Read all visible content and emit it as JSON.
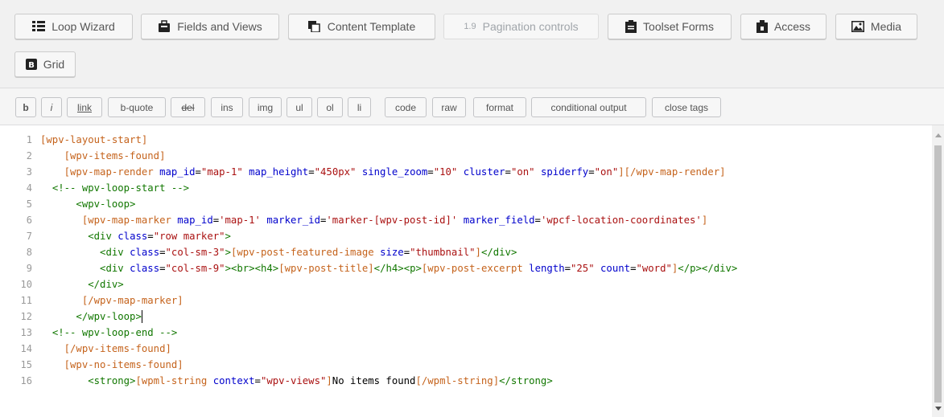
{
  "toolbar": {
    "buttons": [
      {
        "label": "Loop Wizard",
        "icon": "grid-list-icon"
      },
      {
        "label": "Fields and Views",
        "icon": "bag-icon"
      },
      {
        "label": "Content Template",
        "icon": "template-icon"
      },
      {
        "label": "Pagination controls",
        "icon": "pagination-icon",
        "disabled": true
      },
      {
        "label": "Toolset Forms",
        "icon": "clipboard-icon"
      },
      {
        "label": "Access",
        "icon": "access-icon"
      },
      {
        "label": "Media",
        "icon": "image-icon"
      },
      {
        "label": "Grid",
        "icon": "grid-b-icon"
      }
    ],
    "pagination_glyph": "1.9"
  },
  "quicktags": [
    "b",
    "i",
    "link",
    "b-quote",
    "del",
    "ins",
    "img",
    "ul",
    "ol",
    "li",
    "code",
    "raw",
    "format",
    "conditional output",
    "close tags"
  ],
  "editor": {
    "line_numbers": [
      "1",
      "2",
      "3",
      "4",
      "5",
      "6",
      "7",
      "8",
      "9",
      "10",
      "11",
      "12",
      "13",
      "14",
      "15",
      "16"
    ],
    "lines": [
      [
        {
          "t": "sc",
          "v": "[wpv-layout-start]"
        }
      ],
      [
        {
          "t": "p",
          "v": "    "
        },
        {
          "t": "sc",
          "v": "[wpv-items-found]"
        }
      ],
      [
        {
          "t": "p",
          "v": "    "
        },
        {
          "t": "sc",
          "v": "[wpv-map-render "
        },
        {
          "t": "attr",
          "v": "map_id"
        },
        {
          "t": "plain",
          "v": "="
        },
        {
          "t": "str",
          "v": "\"map-1\""
        },
        {
          "t": "plain",
          "v": " "
        },
        {
          "t": "attr",
          "v": "map_height"
        },
        {
          "t": "plain",
          "v": "="
        },
        {
          "t": "str",
          "v": "\"450px\""
        },
        {
          "t": "plain",
          "v": " "
        },
        {
          "t": "attr",
          "v": "single_zoom"
        },
        {
          "t": "plain",
          "v": "="
        },
        {
          "t": "str",
          "v": "\"10\""
        },
        {
          "t": "plain",
          "v": " "
        },
        {
          "t": "attr",
          "v": "cluster"
        },
        {
          "t": "plain",
          "v": "="
        },
        {
          "t": "str",
          "v": "\"on\""
        },
        {
          "t": "plain",
          "v": " "
        },
        {
          "t": "attr",
          "v": "spiderfy"
        },
        {
          "t": "plain",
          "v": "="
        },
        {
          "t": "str",
          "v": "\"on\""
        },
        {
          "t": "sc",
          "v": "][/wpv-map-render]"
        }
      ],
      [
        {
          "t": "p",
          "v": "  "
        },
        {
          "t": "cmt",
          "v": "<!-- wpv-loop-start -->"
        }
      ],
      [
        {
          "t": "p",
          "v": "      "
        },
        {
          "t": "tag",
          "v": "<wpv-loop>"
        }
      ],
      [
        {
          "t": "p",
          "v": "       "
        },
        {
          "t": "sc",
          "v": "[wpv-map-marker "
        },
        {
          "t": "attr",
          "v": "map_id"
        },
        {
          "t": "plain",
          "v": "="
        },
        {
          "t": "str",
          "v": "'map-1'"
        },
        {
          "t": "plain",
          "v": " "
        },
        {
          "t": "attr",
          "v": "marker_id"
        },
        {
          "t": "plain",
          "v": "="
        },
        {
          "t": "str",
          "v": "'marker-[wpv-post-id]'"
        },
        {
          "t": "plain",
          "v": " "
        },
        {
          "t": "attr",
          "v": "marker_field"
        },
        {
          "t": "plain",
          "v": "="
        },
        {
          "t": "str",
          "v": "'wpcf-location-coordinates'"
        },
        {
          "t": "sc",
          "v": "]"
        }
      ],
      [
        {
          "t": "p",
          "v": "        "
        },
        {
          "t": "tag",
          "v": "<div "
        },
        {
          "t": "attr",
          "v": "class"
        },
        {
          "t": "plain",
          "v": "="
        },
        {
          "t": "str",
          "v": "\"row marker\""
        },
        {
          "t": "tag",
          "v": ">"
        }
      ],
      [
        {
          "t": "p",
          "v": "          "
        },
        {
          "t": "tag",
          "v": "<div "
        },
        {
          "t": "attr",
          "v": "class"
        },
        {
          "t": "plain",
          "v": "="
        },
        {
          "t": "str",
          "v": "\"col-sm-3\""
        },
        {
          "t": "tag",
          "v": ">"
        },
        {
          "t": "sc",
          "v": "[wpv-post-featured-image "
        },
        {
          "t": "attr",
          "v": "size"
        },
        {
          "t": "plain",
          "v": "="
        },
        {
          "t": "str",
          "v": "\"thumbnail\""
        },
        {
          "t": "sc",
          "v": "]"
        },
        {
          "t": "tag",
          "v": "</div>"
        }
      ],
      [
        {
          "t": "p",
          "v": "          "
        },
        {
          "t": "tag",
          "v": "<div "
        },
        {
          "t": "attr",
          "v": "class"
        },
        {
          "t": "plain",
          "v": "="
        },
        {
          "t": "str",
          "v": "\"col-sm-9\""
        },
        {
          "t": "tag",
          "v": "><br><h4>"
        },
        {
          "t": "sc",
          "v": "[wpv-post-title]"
        },
        {
          "t": "tag",
          "v": "</h4><p>"
        },
        {
          "t": "sc",
          "v": "[wpv-post-excerpt "
        },
        {
          "t": "attr",
          "v": "length"
        },
        {
          "t": "plain",
          "v": "="
        },
        {
          "t": "str",
          "v": "\"25\""
        },
        {
          "t": "plain",
          "v": " "
        },
        {
          "t": "attr",
          "v": "count"
        },
        {
          "t": "plain",
          "v": "="
        },
        {
          "t": "str",
          "v": "\"word\""
        },
        {
          "t": "sc",
          "v": "]"
        },
        {
          "t": "tag",
          "v": "</p></div>"
        }
      ],
      [
        {
          "t": "p",
          "v": "        "
        },
        {
          "t": "tag",
          "v": "</div>"
        }
      ],
      [
        {
          "t": "p",
          "v": "       "
        },
        {
          "t": "sc",
          "v": "[/wpv-map-marker]"
        }
      ],
      [
        {
          "t": "p",
          "v": "      "
        },
        {
          "t": "tag",
          "v": "</wpv-loop>"
        }
      ],
      [
        {
          "t": "p",
          "v": "  "
        },
        {
          "t": "cmt",
          "v": "<!-- wpv-loop-end -->"
        }
      ],
      [
        {
          "t": "p",
          "v": "    "
        },
        {
          "t": "sc",
          "v": "[/wpv-items-found]"
        }
      ],
      [
        {
          "t": "p",
          "v": "    "
        },
        {
          "t": "sc",
          "v": "[wpv-no-items-found]"
        }
      ],
      [
        {
          "t": "p",
          "v": "        "
        },
        {
          "t": "tag",
          "v": "<strong>"
        },
        {
          "t": "sc",
          "v": "[wpml-string "
        },
        {
          "t": "attr",
          "v": "context"
        },
        {
          "t": "plain",
          "v": "="
        },
        {
          "t": "str",
          "v": "\"wpv-views\""
        },
        {
          "t": "sc",
          "v": "]"
        },
        {
          "t": "plain",
          "v": "No items found"
        },
        {
          "t": "sc",
          "v": "[/wpml-string]"
        },
        {
          "t": "tag",
          "v": "</strong>"
        }
      ]
    ]
  }
}
